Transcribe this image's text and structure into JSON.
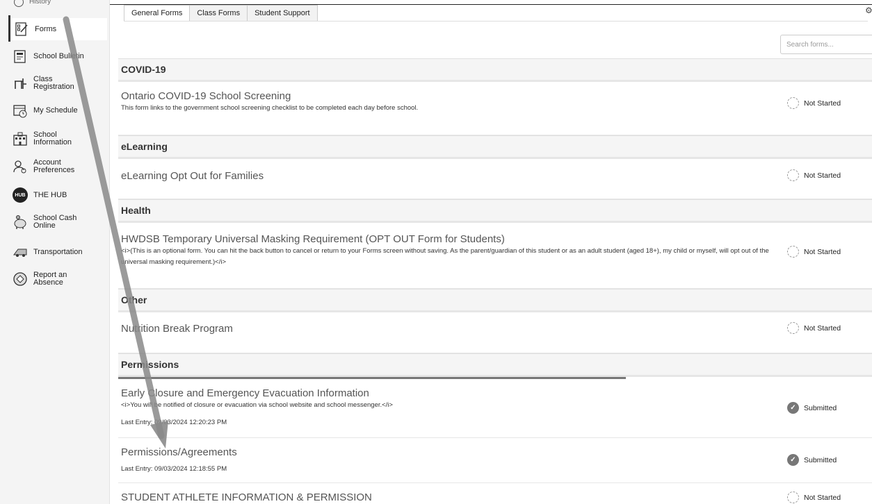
{
  "sidebar": {
    "partial_item": "History",
    "items": [
      {
        "label": "Forms",
        "icon": "forms-icon"
      },
      {
        "label": "School Bulletin",
        "icon": "bulletin-icon"
      },
      {
        "label": "Class Registration",
        "icon": "desk-icon"
      },
      {
        "label": "My Schedule",
        "icon": "calendar-clock-icon"
      },
      {
        "label": "School Information",
        "icon": "school-building-icon"
      },
      {
        "label": "Account Preferences",
        "icon": "account-gear-icon"
      },
      {
        "label": "THE HUB",
        "icon": "hub-badge-icon",
        "badge": "HUB"
      },
      {
        "label": "School Cash Online",
        "icon": "piggy-bank-icon"
      },
      {
        "label": "Transportation",
        "icon": "bus-icon"
      },
      {
        "label": "Report an Absence",
        "icon": "report-absence-icon"
      }
    ]
  },
  "tabs": [
    "General Forms",
    "Class Forms",
    "Student Support"
  ],
  "search": {
    "placeholder": "Search forms..."
  },
  "sections": [
    {
      "title": "COVID-19"
    },
    {
      "title": "eLearning"
    },
    {
      "title": "Health"
    },
    {
      "title": "Other"
    },
    {
      "title": "Permissions"
    }
  ],
  "forms": [
    {
      "title": "Ontario COVID-19 School Screening",
      "desc": "This form links to the government school screening checklist to be completed each day before school.",
      "status": "Not Started"
    },
    {
      "title": "eLearning Opt Out for Families",
      "status": "Not Started"
    },
    {
      "title": "HWDSB Temporary Universal Masking Requirement (OPT OUT Form for Students)",
      "desc": "<i>(This is an optional form. You can hit the back button to cancel or return to your Forms screen without saving. As the parent/guardian of this student or as an adult student (aged 18+), my child or myself, will opt out of the universal masking requirement.)</i>",
      "status": "Not Started"
    },
    {
      "title": "Nutrition Break Program",
      "status": "Not Started"
    },
    {
      "title": "Early Closure and Emergency Evacuation Information",
      "desc": "<i>You will be notified of closure or evacuation via school website and school messenger.</i>",
      "entry": "Last Entry: 09/03/2024 12:20:23 PM",
      "status": "Submitted"
    },
    {
      "title": "Permissions/Agreements",
      "entry": "Last Entry: 09/03/2024 12:18:55 PM",
      "status": "Submitted"
    },
    {
      "title": "STUDENT ATHLETE INFORMATION & PERMISSION",
      "status": "Not Started"
    }
  ],
  "colors": {
    "annotation_arrow": "#8a8a8a",
    "submitted": "#777777"
  }
}
